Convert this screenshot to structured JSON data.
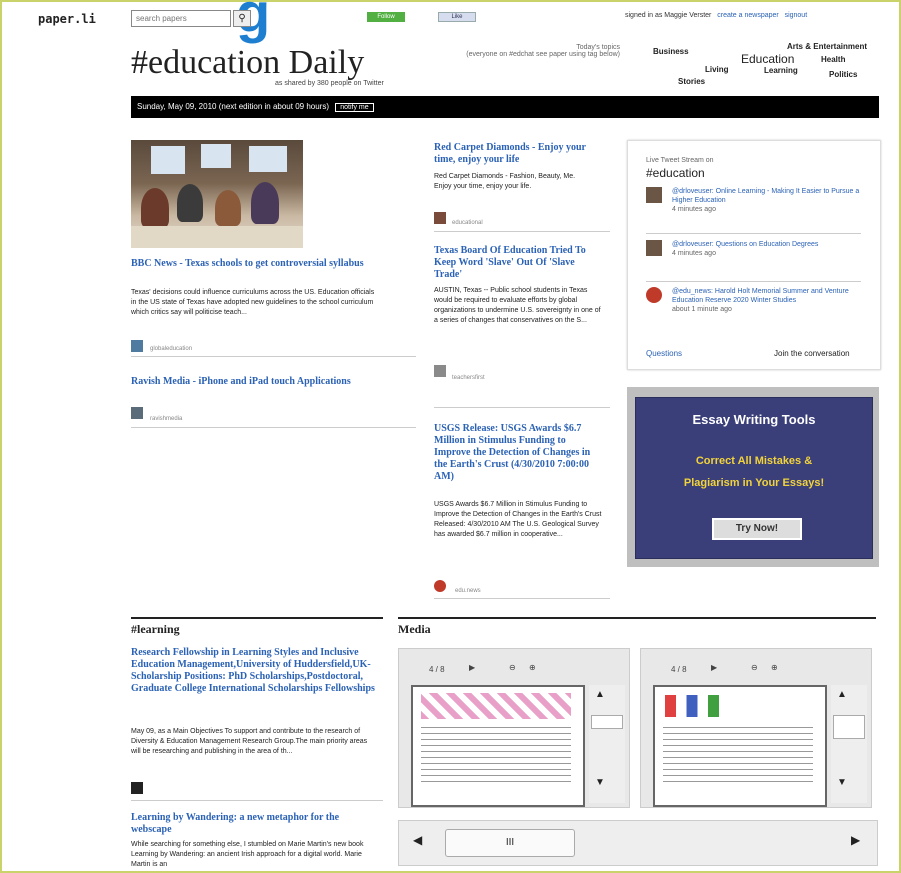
{
  "header": {
    "logo": "paper.li",
    "search_placeholder": "search papers",
    "follow_label": "Follow",
    "like_label": "Like",
    "signed_in_text": "signed in as Maggie Verster",
    "create_link": "create a newspaper",
    "signout_link": "signout"
  },
  "paper": {
    "title": "#education Daily",
    "shared_by": "as shared by 380 people on Twitter",
    "topics_heading": "Today's topics",
    "topics_sub": "(everyone on #edchat see paper using tag below)",
    "date_text": "Sunday, May 09, 2010",
    "next_edition": "(next edition in about 09 hours)",
    "notify_label": "notify me"
  },
  "topics": [
    "Business",
    "Education",
    "Arts & Entertainment",
    "Living",
    "Stories",
    "Learning",
    "Health",
    "Politics"
  ],
  "articles": [
    {
      "title": "BBC News - Texas schools to get controversial syllabus",
      "desc": "Texas' decisions could influence curriculums across the US. Education officials in the US state of Texas have adopted new guidelines to the school curriculum which critics say will politicise teach...",
      "source": "globaleducation"
    },
    {
      "title": "Ravish Media - iPhone and iPad touch Applications",
      "source": "ravishmedia"
    },
    {
      "title": "Red Carpet Diamonds - Enjoy your time, enjoy your life",
      "desc": "Red Carpet Diamonds - Fashion, Beauty, Me. Enjoy your time, enjoy your life.",
      "source": "educational"
    },
    {
      "title": "Texas Board Of Education Tried To Keep Word 'Slave' Out Of 'Slave Trade'",
      "desc": "AUSTIN, Texas -- Public school students in Texas would be required to evaluate efforts by global organizations to undermine U.S. sovereignty in one of a series of changes that conservatives on the S...",
      "source": "teachersfirst"
    },
    {
      "title": "USGS Release: USGS Awards $6.7 Million in Stimulus Funding to Improve the Detection of Changes in the Earth's Crust (4/30/2010 7:00:00 AM)",
      "desc": "USGS Awards $6.7 Million in Stimulus Funding to Improve the Detection of Changes in the Earth's Crust Released: 4/30/2010 AM The U.S. Geological Survey has awarded $6.7 million in cooperative...",
      "source": "edu.news"
    }
  ],
  "twitter": {
    "heading": "Live Tweet Stream on",
    "tag": "#education",
    "tweets": [
      {
        "text": "@drloveuser: Online Learning - Making It Easier to Pursue a Higher Education",
        "ago": "4 minutes ago"
      },
      {
        "text": "@drloveuser: Questions on Education Degrees",
        "ago": "4 minutes ago"
      },
      {
        "text": "@edu_news: Harold Holt Memorial Summer and Venture Education Reserve 2020 Winter Studies",
        "ago": "about 1 minute ago"
      }
    ],
    "questions_link": "Questions",
    "join_link": "Join the conversation"
  },
  "ad": {
    "title": "Essay Writing Tools",
    "line1": "Correct All Mistakes &",
    "line2": "Plagiarism in Your Essays!",
    "button": "Try Now!"
  },
  "learning": {
    "heading": "#learning",
    "articles": [
      {
        "title": "Research Fellowship in Learning Styles and Inclusive Education Management,University of Huddersfield,UK- Scholarship Positions: PhD Scholarships,Postdoctoral, Graduate College International Scholarships Fellowships",
        "desc": "May 09, as a Main Objectives To support and contribute to the research of Diversity & Education Management Research Group.The main priority areas will be researching and publishing in the area of th..."
      },
      {
        "title": "Learning by Wandering: a new metaphor for the webscape",
        "desc": "While searching for something else, I stumbled on Marie Martin's new book Learning by Wandering: an ancient Irish approach for a digital world. Marie Martin is an"
      }
    ]
  },
  "media": {
    "heading": "Media",
    "zoom": "4 / 8"
  }
}
